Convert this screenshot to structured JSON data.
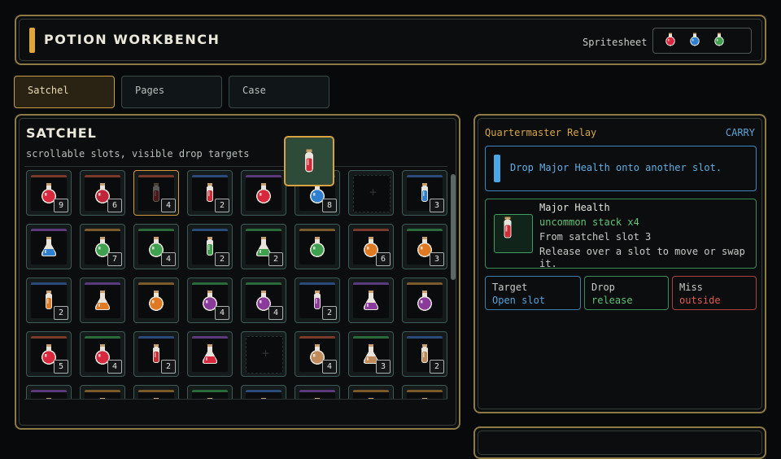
{
  "header": {
    "title": "POTION WORKBENCH",
    "spritesheet_label": "Spritesheet",
    "sprites": [
      {
        "icon": "red-potion-icon",
        "color": "#d8283e"
      },
      {
        "icon": "blue-potion-icon",
        "color": "#2f7fd0"
      },
      {
        "icon": "green-potion-icon",
        "color": "#3fa050"
      }
    ]
  },
  "tabs": [
    {
      "label": "Satchel",
      "active": true
    },
    {
      "label": "Pages",
      "active": false
    },
    {
      "label": "Case",
      "active": false
    }
  ],
  "satchel": {
    "title": "SATCHEL",
    "subtitle": "scrollable slots, visible drop targets",
    "slots": [
      {
        "potion": "round",
        "color": "#d8283e",
        "trim": "#7a3a2a",
        "count": "9"
      },
      {
        "potion": "round",
        "color": "#c0243a",
        "trim": "#7a3a2a",
        "count": "6"
      },
      {
        "potion": "vial",
        "color": "#d02a36",
        "trim": "#7a3a2a",
        "count": "4",
        "dragging": true
      },
      {
        "potion": "vial",
        "color": "#d02a36",
        "trim": "#2a4a7a",
        "count": "2"
      },
      {
        "potion": "round",
        "color": "#d8283e",
        "trim": "#5a3a7a",
        "count": ""
      },
      {
        "potion": "round",
        "color": "#2f7fd0",
        "trim": "#2a4a7a",
        "count": "8"
      },
      {
        "empty": true
      },
      {
        "potion": "vial",
        "color": "#2f7fd0",
        "trim": "#2a4a7a",
        "count": "3"
      },
      {
        "potion": "flask",
        "color": "#2f7fd0",
        "trim": "#5a3a7a",
        "count": ""
      },
      {
        "potion": "round",
        "color": "#3fa050",
        "trim": "#7a5a2a",
        "count": "7"
      },
      {
        "potion": "round",
        "color": "#3fa050",
        "trim": "#2a6a3a",
        "count": "4"
      },
      {
        "potion": "vial",
        "color": "#3fa050",
        "trim": "#2a4a7a",
        "count": "2"
      },
      {
        "potion": "flask",
        "color": "#3fa050",
        "trim": "#2a6a3a",
        "count": "2"
      },
      {
        "potion": "round",
        "color": "#3fa050",
        "trim": "#7a5a2a",
        "count": ""
      },
      {
        "potion": "round",
        "color": "#e07a22",
        "trim": "#7a3a2a",
        "count": "6"
      },
      {
        "potion": "round",
        "color": "#e07a22",
        "trim": "#2a6a3a",
        "count": "3"
      },
      {
        "potion": "vial",
        "color": "#e07a22",
        "trim": "#2a4a7a",
        "count": "2"
      },
      {
        "potion": "flask",
        "color": "#e07a22",
        "trim": "#5a3a7a",
        "count": ""
      },
      {
        "potion": "round",
        "color": "#e07a22",
        "trim": "#7a5a2a",
        "count": ""
      },
      {
        "potion": "round",
        "color": "#8a3a9a",
        "trim": "#2a6a3a",
        "count": "4"
      },
      {
        "potion": "round",
        "color": "#8a3a9a",
        "trim": "#2a6a3a",
        "count": "4"
      },
      {
        "potion": "vial",
        "color": "#8a3a9a",
        "trim": "#2a4a7a",
        "count": "2"
      },
      {
        "potion": "flask",
        "color": "#8a3a9a",
        "trim": "#5a3a7a",
        "count": ""
      },
      {
        "potion": "round",
        "color": "#8a3a9a",
        "trim": "#7a5a2a",
        "count": ""
      },
      {
        "potion": "round",
        "color": "#d8283e",
        "trim": "#7a3a2a",
        "count": "5"
      },
      {
        "potion": "round",
        "color": "#d8283e",
        "trim": "#2a6a3a",
        "count": "4"
      },
      {
        "potion": "vial",
        "color": "#d02a36",
        "trim": "#2a4a7a",
        "count": "2"
      },
      {
        "potion": "flask",
        "color": "#d8283e",
        "trim": "#5a3a7a",
        "count": ""
      },
      {
        "empty": true
      },
      {
        "potion": "round",
        "color": "#c08a5a",
        "trim": "#7a3a2a",
        "count": "4"
      },
      {
        "potion": "flask",
        "color": "#c08a5a",
        "trim": "#2a6a3a",
        "count": "3"
      },
      {
        "potion": "vial",
        "color": "#c08a5a",
        "trim": "#2a4a7a",
        "count": "2"
      },
      {
        "potion": "round",
        "color": "#d8283e",
        "trim": "#5a3a7a",
        "count": ""
      },
      {
        "potion": "round",
        "color": "#e07a22",
        "trim": "#7a5a2a",
        "count": ""
      },
      {
        "potion": "round",
        "color": "#d8283e",
        "trim": "#7a5a2a",
        "count": ""
      },
      {
        "potion": "round",
        "color": "#3fa050",
        "trim": "#2a6a3a",
        "count": ""
      },
      {
        "potion": "round",
        "color": "#2f7fd0",
        "trim": "#2a4a7a",
        "count": ""
      },
      {
        "potion": "round",
        "color": "#8a3a9a",
        "trim": "#5a3a7a",
        "count": ""
      },
      {
        "potion": "round",
        "color": "#e07a22",
        "trim": "#7a5a2a",
        "count": ""
      },
      {
        "potion": "round",
        "color": "#c08a5a",
        "trim": "#7a5a2a",
        "count": ""
      }
    ]
  },
  "drag_ghost": {
    "potion": "vial",
    "color": "#d02a36"
  },
  "relay": {
    "title": "Quartermaster Relay",
    "mode": "CARRY",
    "message": "Drop Major Health onto another slot.",
    "item": {
      "name": "Major Health",
      "rarity": "uncommon stack x4",
      "from": "From satchel slot 3",
      "hint": "Release over a slot to move or swap it.",
      "color": "#d02a36"
    },
    "stats": {
      "target_label": "Target",
      "target_value": "Open slot",
      "drop_label": "Drop",
      "drop_value": "release",
      "miss_label": "Miss",
      "miss_value": "outside"
    }
  }
}
